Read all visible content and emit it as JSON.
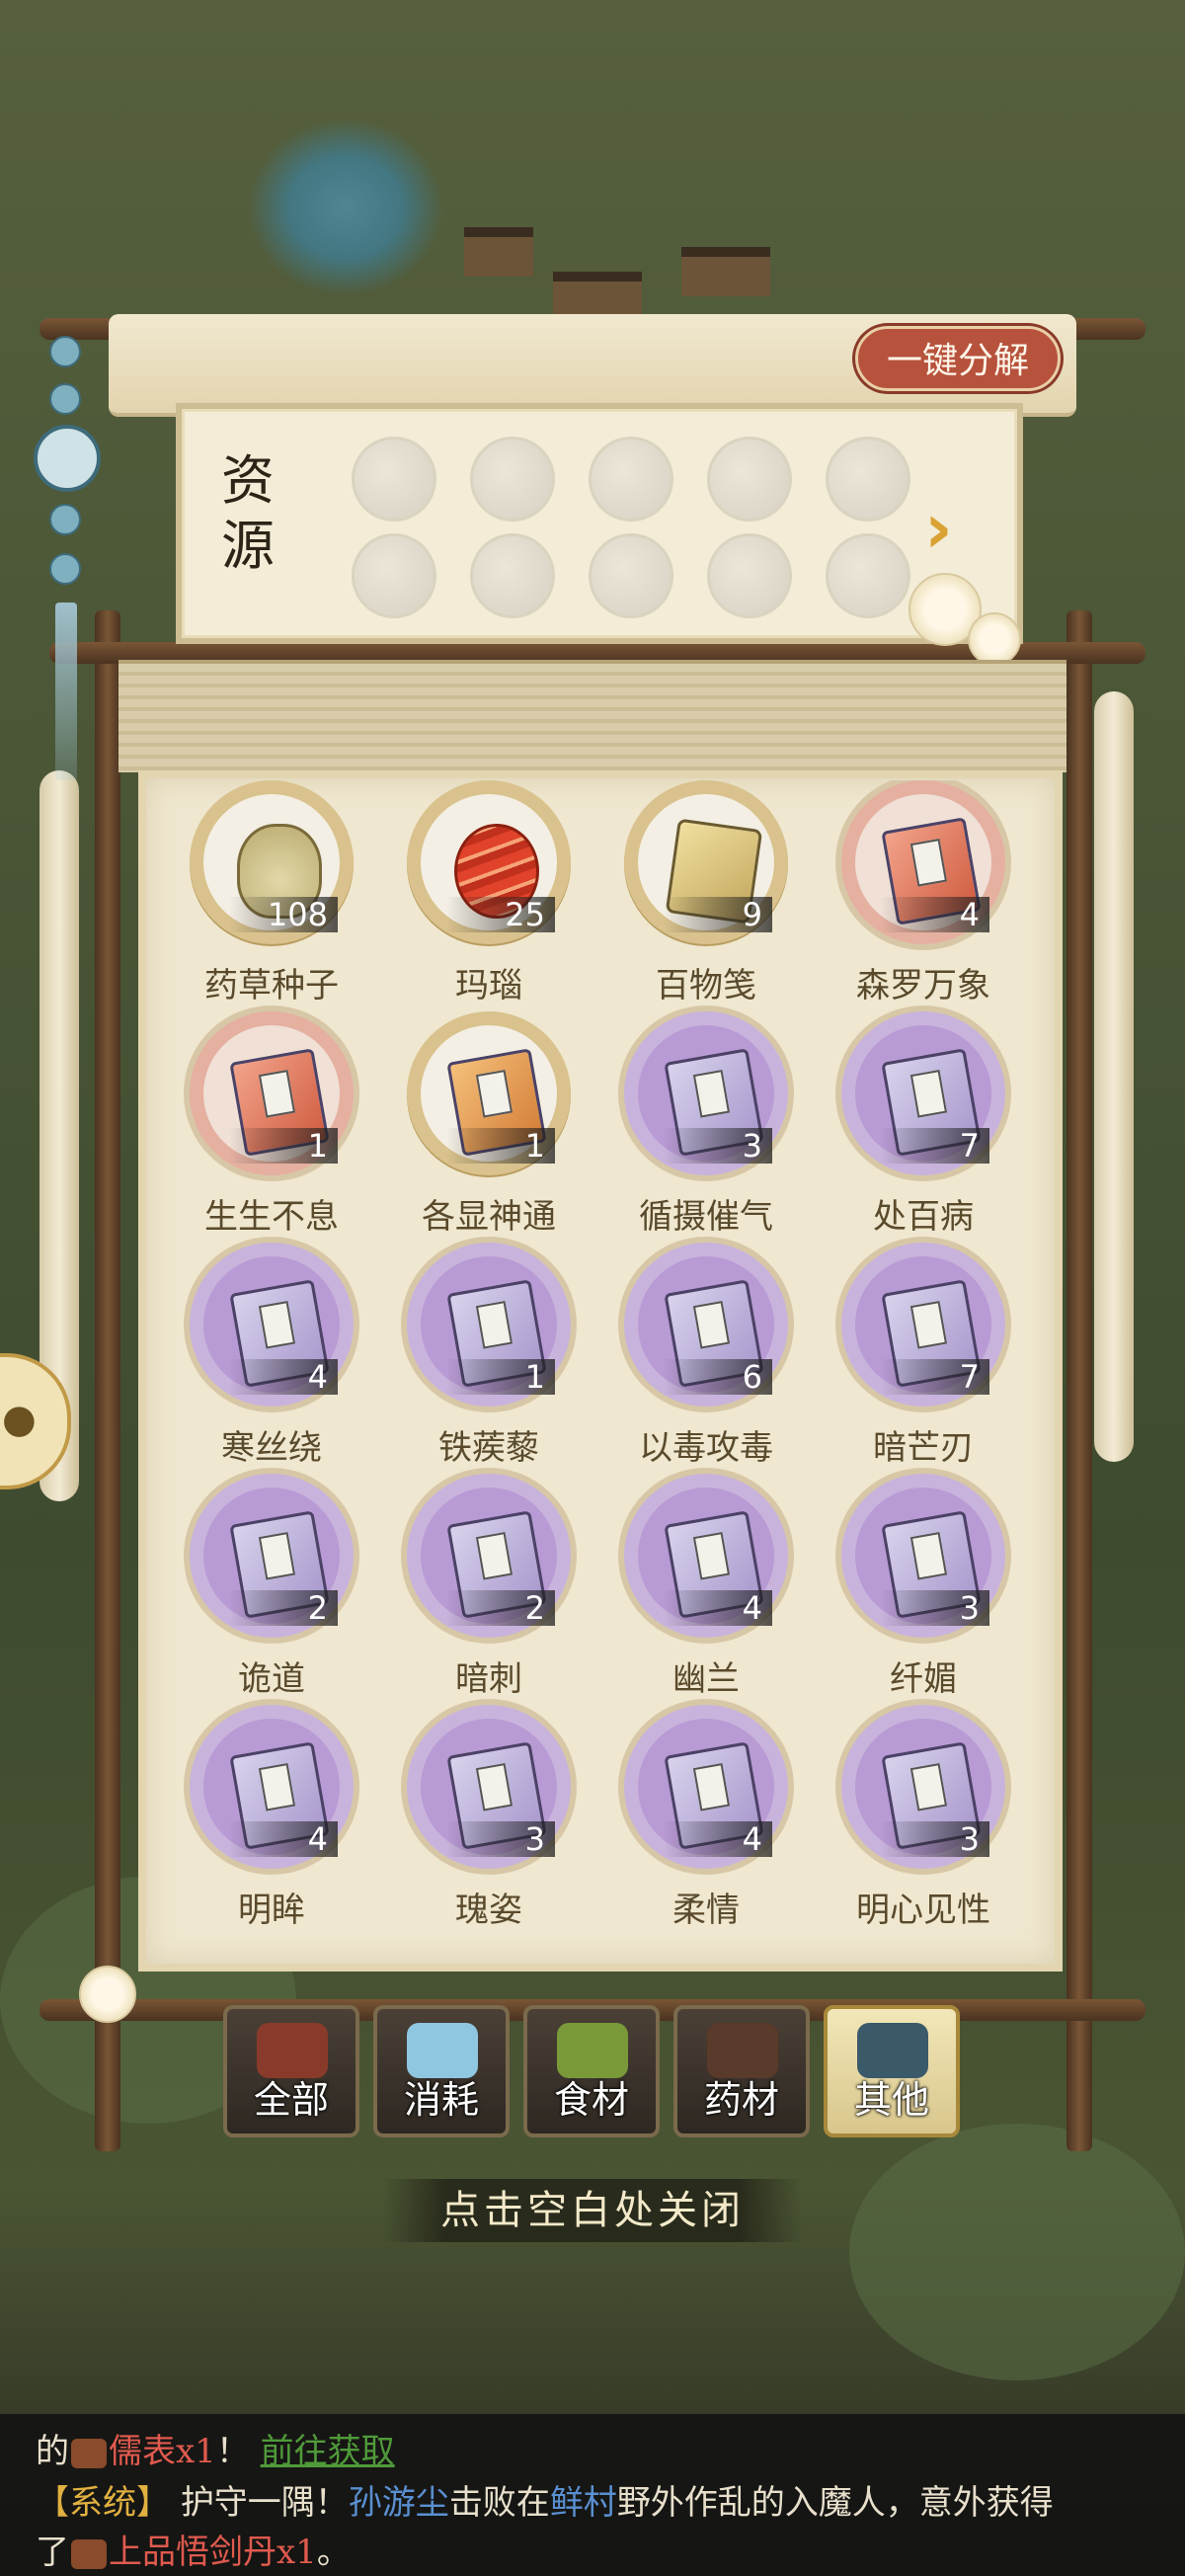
{
  "header": {
    "decompose_label": "一键分解"
  },
  "resources": {
    "label": "资源",
    "slot_count": 10,
    "arrow": "›"
  },
  "items": [
    {
      "name": "药草种子",
      "count": "108",
      "icon": "seed-sack-icon",
      "style": "gold"
    },
    {
      "name": "玛瑙",
      "count": "25",
      "icon": "agate-icon",
      "style": "gold"
    },
    {
      "name": "百物笺",
      "count": "9",
      "icon": "scroll-box-icon",
      "style": "gold"
    },
    {
      "name": "森罗万象",
      "count": "4",
      "icon": "red-manual-icon",
      "style": "red"
    },
    {
      "name": "生生不息",
      "count": "1",
      "icon": "red-manual-icon",
      "style": "red"
    },
    {
      "name": "各显神通",
      "count": "1",
      "icon": "orange-manual-icon",
      "style": "gold"
    },
    {
      "name": "循摄催气",
      "count": "3",
      "icon": "purple-manual-icon",
      "style": "purple"
    },
    {
      "name": "处百病",
      "count": "7",
      "icon": "purple-manual-icon",
      "style": "purple"
    },
    {
      "name": "寒丝绕",
      "count": "4",
      "icon": "purple-manual-icon",
      "style": "purple"
    },
    {
      "name": "铁蒺藜",
      "count": "1",
      "icon": "purple-manual-icon",
      "style": "purple"
    },
    {
      "name": "以毒攻毒",
      "count": "6",
      "icon": "purple-manual-icon",
      "style": "purple"
    },
    {
      "name": "暗芒刃",
      "count": "7",
      "icon": "purple-manual-icon",
      "style": "purple"
    },
    {
      "name": "诡道",
      "count": "2",
      "icon": "purple-manual-icon",
      "style": "purple"
    },
    {
      "name": "暗刺",
      "count": "2",
      "icon": "purple-manual-icon",
      "style": "purple"
    },
    {
      "name": "幽兰",
      "count": "4",
      "icon": "purple-manual-icon",
      "style": "purple"
    },
    {
      "name": "纤媚",
      "count": "3",
      "icon": "purple-manual-icon",
      "style": "purple"
    },
    {
      "name": "明眸",
      "count": "4",
      "icon": "purple-manual-icon",
      "style": "purple"
    },
    {
      "name": "瑰姿",
      "count": "3",
      "icon": "purple-manual-icon",
      "style": "purple"
    },
    {
      "name": "柔情",
      "count": "4",
      "icon": "purple-manual-icon",
      "style": "purple"
    },
    {
      "name": "明心见性",
      "count": "3",
      "icon": "purple-manual-icon",
      "style": "purple"
    }
  ],
  "tabs": [
    {
      "label": "全部",
      "icon": "treasure-chest-icon",
      "active": false,
      "color": "#8a3a2a"
    },
    {
      "label": "消耗",
      "icon": "potion-icon",
      "active": false,
      "color": "#8fc6e0"
    },
    {
      "label": "食材",
      "icon": "vegetable-basket-icon",
      "active": false,
      "color": "#7a9a3a"
    },
    {
      "label": "药材",
      "icon": "herb-pot-icon",
      "active": false,
      "color": "#5a3a2a"
    },
    {
      "label": "其他",
      "icon": "gold-pot-icon",
      "active": true,
      "color": "#3a5a6a"
    }
  ],
  "close_hint": "点击空白处关闭",
  "chat": {
    "line1": {
      "prefix": "的",
      "item": "儒表x1",
      "suffix": "！",
      "link": "前往获取"
    },
    "line2": {
      "tag": "【系统】",
      "text1": "护守一隅！",
      "player": "孙游尘",
      "text2": "击败在",
      "place": "鲜村",
      "text3": "野外作乱的入魔人，意外获得"
    },
    "line3": {
      "prefix": "了",
      "item": "上品悟剑丹x1",
      "suffix": "。"
    }
  },
  "colors": {
    "accent_red": "#b7523c",
    "paper": "#efe7cf",
    "purple_ring": "#c8b3dc"
  }
}
